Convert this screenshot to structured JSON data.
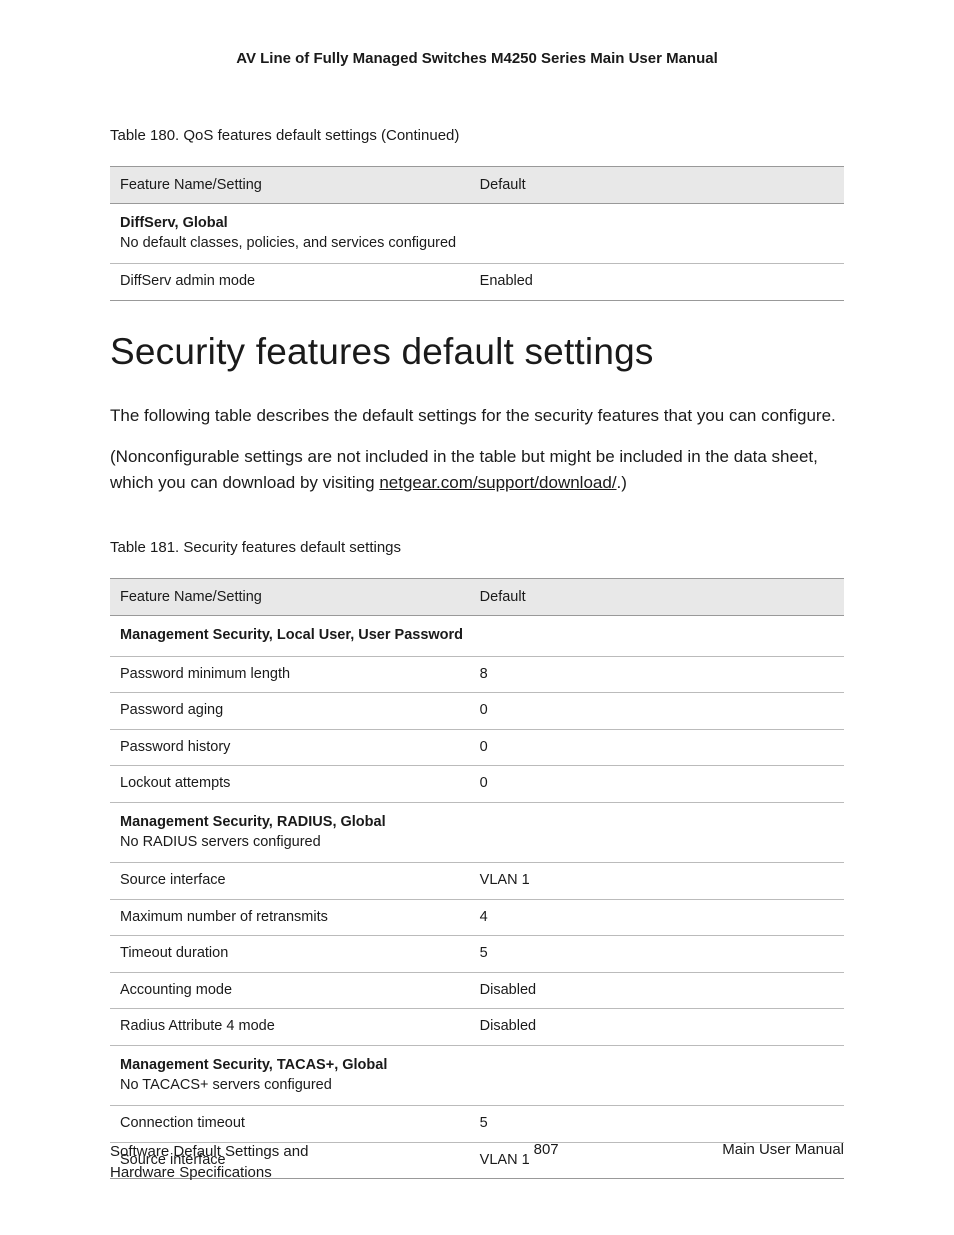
{
  "header": {
    "title": "AV Line of Fully Managed Switches M4250 Series Main User Manual"
  },
  "table180": {
    "caption": "Table 180. QoS features default settings (Continued)",
    "headers": {
      "col1": "Feature Name/Setting",
      "col2": "Default"
    },
    "section": {
      "title": "DiffServ, Global",
      "subtitle": "No default classes, policies, and services configured"
    },
    "rows": [
      {
        "name": "DiffServ admin mode",
        "default": "Enabled"
      }
    ]
  },
  "section": {
    "heading": "Security features default settings",
    "p1": "The following table describes the default settings for the security features that you can configure.",
    "p2a": "(Nonconfigurable settings are not included in the table but might be included in the data sheet, which you can download by visiting ",
    "p2link": "netgear.com/support/download/",
    "p2b": ".)"
  },
  "table181": {
    "caption": "Table 181. Security features default settings",
    "headers": {
      "col1": "Feature Name/Setting",
      "col2": "Default"
    },
    "section1": {
      "title": "Management Security, Local User, User Password"
    },
    "rows1": [
      {
        "name": "Password minimum length",
        "default": "8"
      },
      {
        "name": "Password aging",
        "default": "0"
      },
      {
        "name": "Password history",
        "default": "0"
      },
      {
        "name": "Lockout attempts",
        "default": "0"
      }
    ],
    "section2": {
      "title": "Management Security, RADIUS, Global",
      "subtitle": "No RADIUS servers configured"
    },
    "rows2": [
      {
        "name": "Source interface",
        "default": "VLAN 1"
      },
      {
        "name": "Maximum number of retransmits",
        "default": "4"
      },
      {
        "name": "Timeout duration",
        "default": "5"
      },
      {
        "name": "Accounting mode",
        "default": "Disabled"
      },
      {
        "name": "Radius Attribute 4 mode",
        "default": "Disabled"
      }
    ],
    "section3": {
      "title": "Management Security, TACAS+, Global",
      "subtitle": "No TACACS+ servers configured"
    },
    "rows3": [
      {
        "name": "Connection timeout",
        "default": "5"
      },
      {
        "name": "Source interface",
        "default": "VLAN 1"
      }
    ]
  },
  "footer": {
    "left": "Software Default Settings and Hardware Specifications",
    "center": "807",
    "right": "Main User Manual"
  }
}
